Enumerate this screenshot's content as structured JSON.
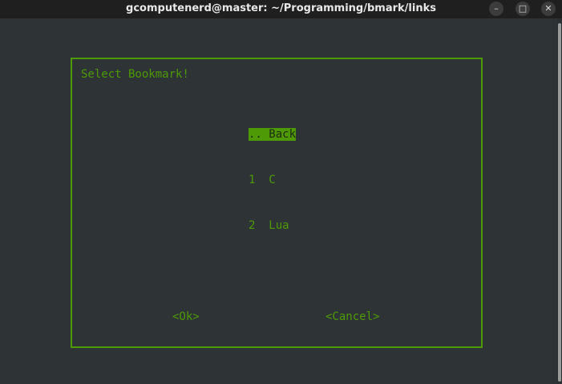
{
  "window": {
    "title": "gcomputenerd@master: ~/Programming/bmark/links",
    "minimize_icon": "minimize-icon",
    "maximize_icon": "maximize-icon",
    "close_icon": "close-icon",
    "minimize_glyph": "–",
    "maximize_glyph": "□",
    "close_glyph": "✕"
  },
  "dialog": {
    "title": "Select Bookmark!",
    "items": [
      {
        "tag": "..",
        "label": "Back",
        "selected": true
      },
      {
        "tag": "1",
        "label": "C",
        "selected": false
      },
      {
        "tag": "2",
        "label": "Lua",
        "selected": false
      }
    ],
    "ok_label": "<Ok>",
    "cancel_label": "<Cancel>"
  },
  "colors": {
    "accent": "#4e9a06",
    "background": "#2e3436",
    "titlebar": "#1f1f1f"
  }
}
